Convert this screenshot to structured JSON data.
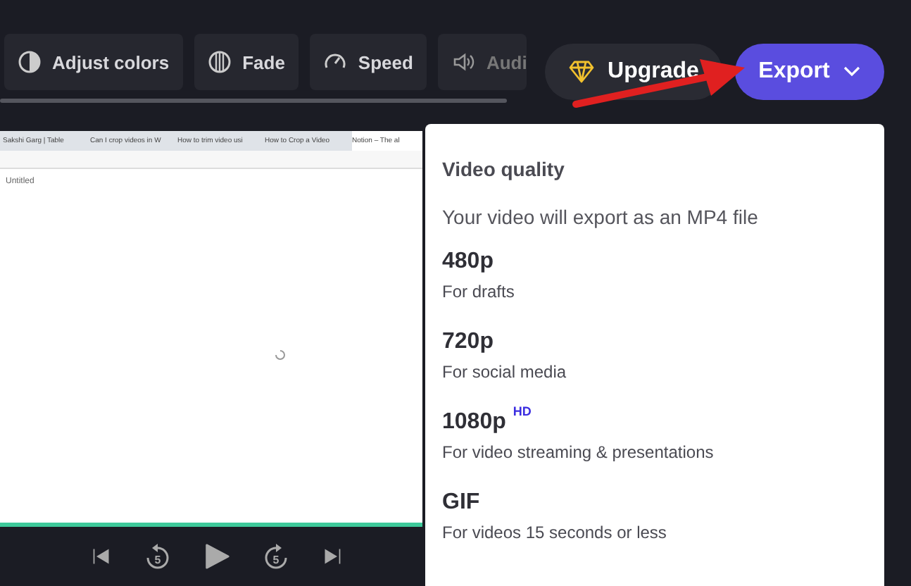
{
  "toolbar": {
    "tools": [
      {
        "kind": "contrast",
        "label": "Adjust colors"
      },
      {
        "kind": "fade",
        "label": "Fade"
      },
      {
        "kind": "speed",
        "label": "Speed"
      },
      {
        "kind": "audio",
        "label": "Audi"
      }
    ]
  },
  "upgrade_button": {
    "label": "Upgrade"
  },
  "export_button": {
    "label": "Export",
    "expanded": true
  },
  "preview": {
    "browser_tabs": [
      {
        "title": "Sakshi Garg | Table"
      },
      {
        "title": "Can I crop videos in W"
      },
      {
        "title": "How to trim video usi"
      },
      {
        "title": "How to Crop a Video"
      },
      {
        "title": "Notion – The al"
      }
    ],
    "page_title": "Untitled"
  },
  "player": {
    "controls": [
      {
        "kind": "start"
      },
      {
        "kind": "back",
        "label": "5"
      },
      {
        "kind": "play"
      },
      {
        "kind": "forward",
        "label": "5"
      },
      {
        "kind": "end"
      }
    ]
  },
  "export_menu": {
    "heading": "Video quality",
    "note": "Your video will export as an MP4 file",
    "options": [
      {
        "label": "480p",
        "description": "For drafts"
      },
      {
        "label": "720p",
        "description": "For social media"
      },
      {
        "label": "1080p",
        "badge": "HD",
        "description": "For video streaming & presentations"
      },
      {
        "label": "GIF",
        "description": "For videos 15 seconds or less"
      }
    ]
  }
}
